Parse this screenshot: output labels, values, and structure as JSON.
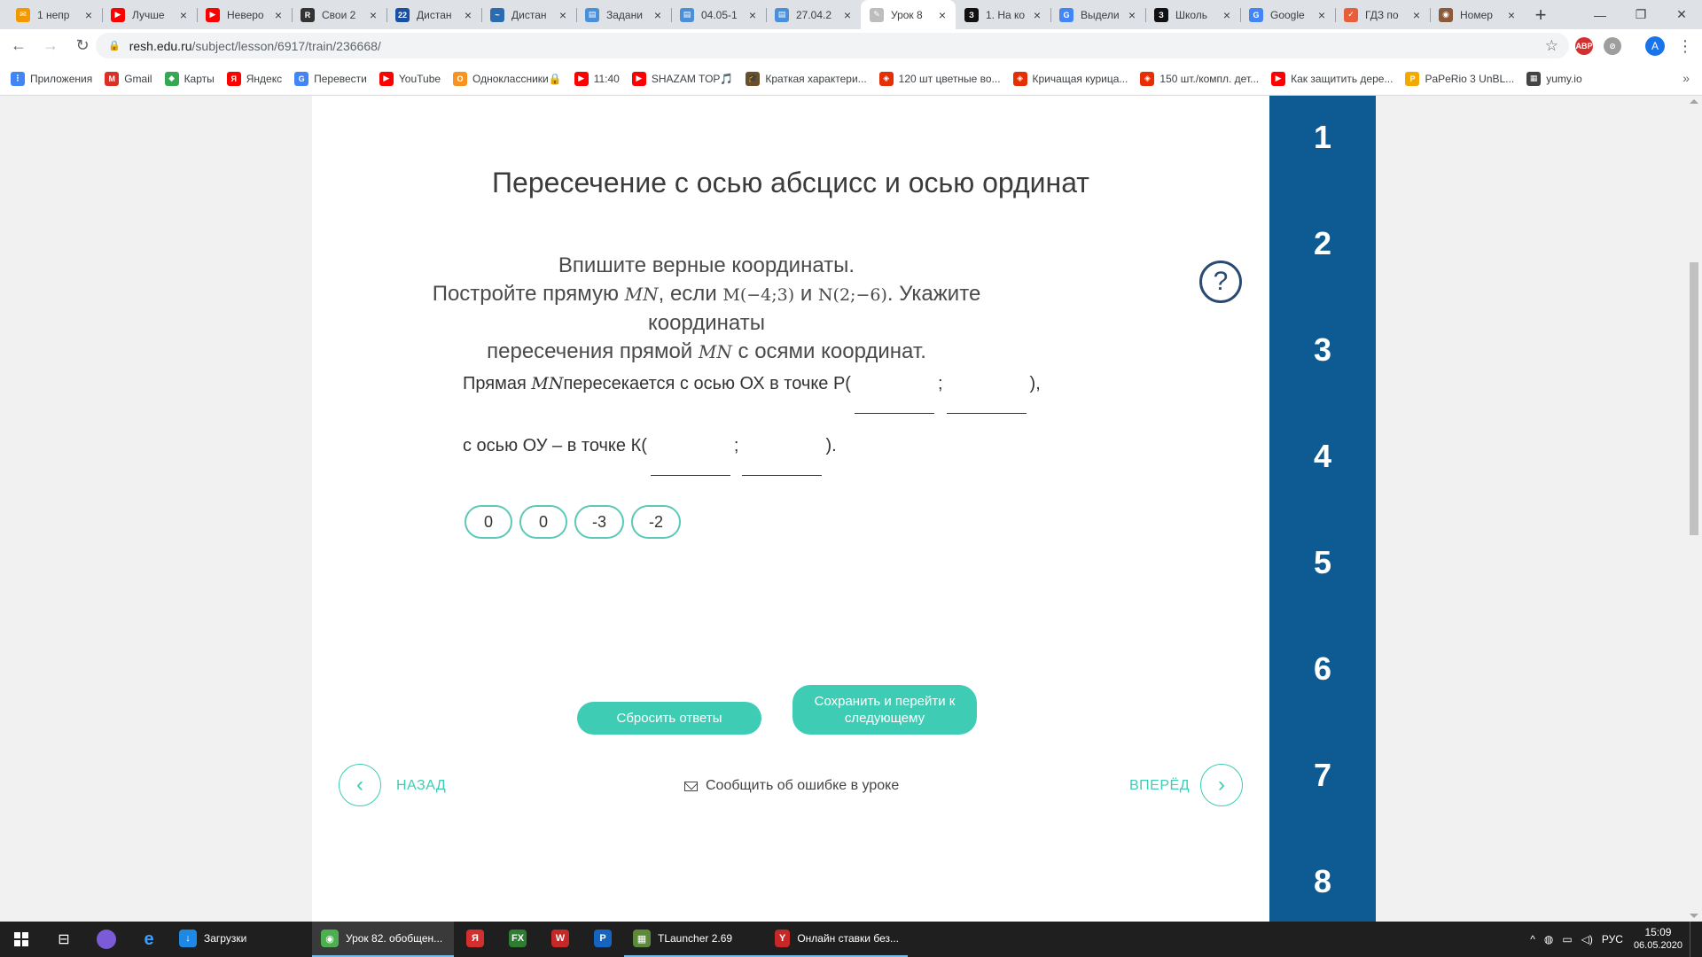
{
  "browser": {
    "tabs": [
      {
        "label": "1 непр",
        "color": "#f29900",
        "glyph": "✉"
      },
      {
        "label": "Лучше",
        "color": "#ff0000",
        "glyph": "▶"
      },
      {
        "label": "Неверо",
        "color": "#ff0000",
        "glyph": "▶"
      },
      {
        "label": "Свои 2",
        "color": "#333333",
        "glyph": "R"
      },
      {
        "label": "Дистан",
        "color": "#1a4fa3",
        "glyph": "22"
      },
      {
        "label": "Дистан",
        "color": "#2b6cb0",
        "glyph": "~"
      },
      {
        "label": "Задани",
        "color": "#4a8fd8",
        "glyph": "▤"
      },
      {
        "label": "04.05-1",
        "color": "#4a8fd8",
        "glyph": "▤"
      },
      {
        "label": "27.04.2",
        "color": "#4a8fd8",
        "glyph": "▤"
      },
      {
        "label": "Урок 8",
        "color": "#bdbdbd",
        "glyph": "✎",
        "active": true
      },
      {
        "label": "1. На ко",
        "color": "#111111",
        "glyph": "З"
      },
      {
        "label": "Выдели",
        "color": "#4285f4",
        "glyph": "G"
      },
      {
        "label": "Школь",
        "color": "#111111",
        "glyph": "З"
      },
      {
        "label": "Google",
        "color": "#4285f4",
        "glyph": "G"
      },
      {
        "label": "ГДЗ по",
        "color": "#e85d3a",
        "glyph": "✓"
      },
      {
        "label": "Номер",
        "color": "#8a5a3b",
        "glyph": "◉"
      }
    ],
    "new_tab": "+",
    "window_controls": {
      "minimize": "—",
      "maximize": "❐",
      "close": "✕"
    },
    "url": {
      "host": "resh.edu.ru",
      "path": "/subject/lesson/6917/train/236668/"
    },
    "bookmarks": [
      {
        "label": "Приложения",
        "color": "#4285f4",
        "glyph": "⋮"
      },
      {
        "label": "Gmail",
        "color": "#d93025",
        "glyph": "M"
      },
      {
        "label": "Карты",
        "color": "#34a853",
        "glyph": "◆"
      },
      {
        "label": "Яндекс",
        "color": "#ff0000",
        "glyph": "Я"
      },
      {
        "label": "Перевести",
        "color": "#4285f4",
        "glyph": "G"
      },
      {
        "label": "YouTube",
        "color": "#ff0000",
        "glyph": "▶"
      },
      {
        "label": "Одноклассники🔒",
        "color": "#f7931e",
        "glyph": "О"
      },
      {
        "label": "11:40",
        "color": "#ff0000",
        "glyph": "▶"
      },
      {
        "label": "SHAZAM TOP🎵",
        "color": "#ff0000",
        "glyph": "▶"
      },
      {
        "label": "Краткая характери...",
        "color": "#6b4f2a",
        "glyph": "🎓"
      },
      {
        "label": "120 шт цветные во...",
        "color": "#e62e04",
        "glyph": "◈"
      },
      {
        "label": "Кричащая курица...",
        "color": "#e62e04",
        "glyph": "◈"
      },
      {
        "label": "150 шт./компл. дет...",
        "color": "#e62e04",
        "glyph": "◈"
      },
      {
        "label": "Как защитить дере...",
        "color": "#ff0000",
        "glyph": "▶"
      },
      {
        "label": "PaPeRio 3 UnBL...",
        "color": "#f2a900",
        "glyph": "P"
      },
      {
        "label": "yumy.io",
        "color": "#444444",
        "glyph": "▦"
      }
    ],
    "bookmarks_more": "»",
    "profile_letter": "A"
  },
  "lesson": {
    "title": "Пересечение с осью абсцисс и осью ординат",
    "task_line1": "Впишите верные координаты.",
    "task_line2_a": "Постройте прямую ",
    "task_mn": "MN",
    "task_line2_b": ", если ",
    "task_m_point": "M(−4;3)",
    "task_and": " и ",
    "task_n_point": "N(2;−6)",
    "task_line2_c": ". Укажите координаты",
    "task_line3_a": "пересечения прямой ",
    "task_line3_b": " с осями координат.",
    "help_icon": "?",
    "row1_prefix": "Прямая ",
    "row1_text": " пересекается с осью ОХ в точке Р(",
    "row1_sep": ";",
    "row1_end": "),",
    "row2_text": "с осью ОУ – в точке К(",
    "row2_sep": ";",
    "row2_end": ").",
    "chips": [
      "0",
      "0",
      "-3",
      "-2"
    ],
    "reset_label": "Сбросить ответы",
    "save_label": "Сохранить и перейти к следующему",
    "prev_label": "НАЗАД",
    "next_label": "ВПЕРЁД",
    "report_label": "Сообщить об ошибке в уроке",
    "steps": [
      "1",
      "2",
      "3",
      "4",
      "5",
      "6",
      "7",
      "8"
    ]
  },
  "taskbar": {
    "apps": [
      {
        "label": "Загрузки",
        "color": "#1e88e5",
        "glyph": "↓",
        "state": "wide"
      },
      {
        "label": "Урок 82. обобщен...",
        "color": "#4caf50",
        "glyph": "◉",
        "state": "active"
      },
      {
        "label": "",
        "color": "#d32f2f",
        "glyph": "Я",
        "state": "icon"
      },
      {
        "label": "",
        "color": "#2e7d32",
        "glyph": "FX",
        "state": "icon"
      },
      {
        "label": "",
        "color": "#c62828",
        "glyph": "W",
        "state": "icon"
      },
      {
        "label": "",
        "color": "#1565c0",
        "glyph": "P",
        "state": "icon"
      },
      {
        "label": "TLauncher 2.69",
        "color": "#5d8a3a",
        "glyph": "▦",
        "state": "run"
      },
      {
        "label": "Онлайн ставки без...",
        "color": "#c62828",
        "glyph": "Y",
        "state": "run"
      }
    ],
    "tray": {
      "chevron": "^",
      "lang": "РУС",
      "time": "15:09",
      "date": "06.05.2020"
    }
  }
}
